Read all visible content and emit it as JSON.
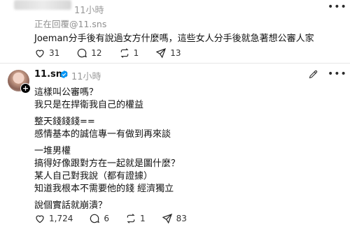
{
  "top_post": {
    "time": "11小時",
    "replying_to": "正在回覆@11.sns",
    "text": "Joeman分手後有說過女方什麼嗎，這些女人分手後就急著想公審人家",
    "actions": {
      "likes": "31",
      "replies": "12",
      "reposts": "1",
      "shares": "13"
    }
  },
  "main_post": {
    "username": "11.sns",
    "time": "11小時",
    "lines": [
      "這樣叫公審嗎？",
      "我只是在捍衛我自己的權益",
      "整天錢錢錢==",
      "感情基本的誠信專一有做到再來談",
      "一堆男權",
      "搞得好像跟對方在一起就是圖什麼？",
      "某人自己對我說（都有證據）",
      "知道我根本不需要他的錢 經濟獨立",
      "說個實話就崩潰？"
    ],
    "actions": {
      "likes": "1,724",
      "replies": "6",
      "reposts": "1",
      "shares": "83"
    }
  },
  "icons": {
    "more": "more-icon",
    "like": "heart-icon",
    "reply": "comment-icon",
    "repost": "repost-icon",
    "share": "send-icon",
    "verified": "verified-badge-icon",
    "edit": "edit-pencil-icon",
    "follow": "plus-icon"
  },
  "colors": {
    "text": "#0f0f0f",
    "muted": "#9a9a9a",
    "verified": "#0095f6",
    "divider": "#e6e6e6"
  }
}
